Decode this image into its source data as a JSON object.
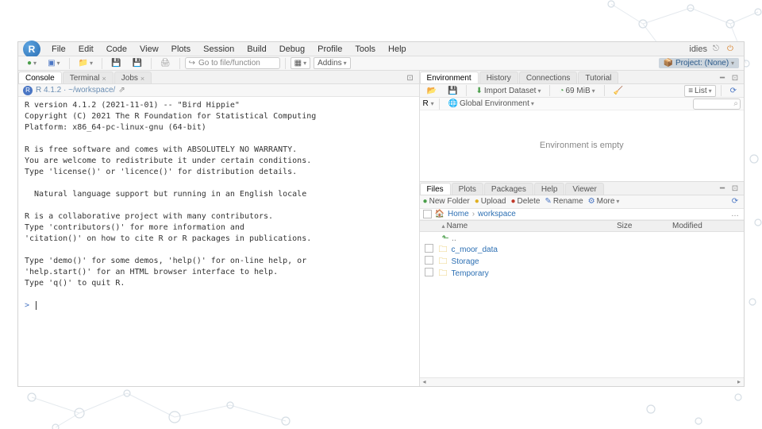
{
  "menu": [
    "File",
    "Edit",
    "Code",
    "View",
    "Plots",
    "Session",
    "Build",
    "Debug",
    "Profile",
    "Tools",
    "Help"
  ],
  "user": "idies",
  "project_label": "Project: (None)",
  "toolbar": {
    "goto": "Go to file/function",
    "addins": "Addins"
  },
  "left_tabs": [
    {
      "label": "Console",
      "active": true,
      "closable": false
    },
    {
      "label": "Terminal",
      "active": false,
      "closable": true
    },
    {
      "label": "Jobs",
      "active": false,
      "closable": true
    }
  ],
  "console_sub": "R 4.1.2 · ~/workspace/",
  "console_text": "R version 4.1.2 (2021-11-01) -- \"Bird Hippie\"\nCopyright (C) 2021 The R Foundation for Statistical Computing\nPlatform: x86_64-pc-linux-gnu (64-bit)\n\nR is free software and comes with ABSOLUTELY NO WARRANTY.\nYou are welcome to redistribute it under certain conditions.\nType 'license()' or 'licence()' for distribution details.\n\n  Natural language support but running in an English locale\n\nR is a collaborative project with many contributors.\nType 'contributors()' for more information and\n'citation()' on how to cite R or R packages in publications.\n\nType 'demo()' for some demos, 'help()' for on-line help, or\n'help.start()' for an HTML browser interface to help.\nType 'q()' to quit R.\n",
  "prompt": ">",
  "env_tabs": [
    {
      "label": "Environment",
      "active": true
    },
    {
      "label": "History",
      "active": false
    },
    {
      "label": "Connections",
      "active": false
    },
    {
      "label": "Tutorial",
      "active": false
    }
  ],
  "env_toolbar": {
    "import": "Import Dataset",
    "memory": "69 MiB",
    "list": "List"
  },
  "env_scope": {
    "lang": "R",
    "scope": "Global Environment"
  },
  "env_empty": "Environment is empty",
  "file_tabs": [
    {
      "label": "Files",
      "active": true
    },
    {
      "label": "Plots",
      "active": false
    },
    {
      "label": "Packages",
      "active": false
    },
    {
      "label": "Help",
      "active": false
    },
    {
      "label": "Viewer",
      "active": false
    }
  ],
  "files_toolbar": {
    "new_folder": "New Folder",
    "upload": "Upload",
    "delete": "Delete",
    "rename": "Rename",
    "more": "More"
  },
  "breadcrumb": [
    "Home",
    "workspace"
  ],
  "file_columns": {
    "name": "Name",
    "size": "Size",
    "modified": "Modified"
  },
  "files": [
    {
      "name": "c_moor_data",
      "type": "folder"
    },
    {
      "name": "Storage",
      "type": "folder"
    },
    {
      "name": "Temporary",
      "type": "folder"
    }
  ]
}
